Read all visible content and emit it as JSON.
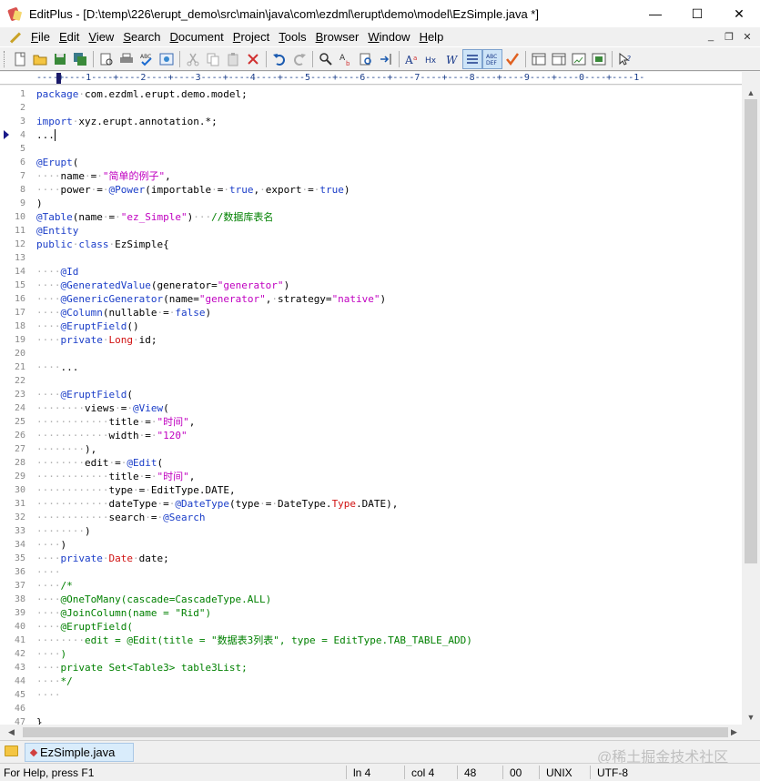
{
  "window": {
    "title": "EditPlus - [D:\\temp\\226\\erupt_demo\\src\\main\\java\\com\\ezdml\\erupt\\demo\\model\\EzSimple.java *]",
    "minimize": "—",
    "maximize": "☐",
    "close": "✕"
  },
  "menu": [
    {
      "accel": "F",
      "rest": "ile"
    },
    {
      "accel": "E",
      "rest": "dit"
    },
    {
      "accel": "V",
      "rest": "iew"
    },
    {
      "accel": "S",
      "rest": "earch"
    },
    {
      "accel": "D",
      "rest": "ocument"
    },
    {
      "accel": "P",
      "rest": "roject"
    },
    {
      "accel": "T",
      "rest": "ools"
    },
    {
      "accel": "B",
      "rest": "rowser"
    },
    {
      "accel": "W",
      "rest": "indow"
    },
    {
      "accel": "H",
      "rest": "elp"
    }
  ],
  "mdi_controls": {
    "minimize": "_",
    "restore": "❐",
    "close": "✕"
  },
  "ruler_text": "----+----1----+----2----+----3----+----4----+----5----+----6----+----7----+----8----+----9----+----0----+----1-",
  "editor": {
    "current_line": 4,
    "lines": [
      {
        "n": "1",
        "parts": [
          [
            "kw",
            "package"
          ],
          [
            "dot",
            "·"
          ],
          [
            "",
            "com.ezdml.erupt.demo.model;"
          ]
        ]
      },
      {
        "n": "2",
        "parts": []
      },
      {
        "n": "3",
        "parts": [
          [
            "kw",
            "import"
          ],
          [
            "dot",
            "·"
          ],
          [
            "",
            "xyz.erupt.annotation.*;"
          ]
        ]
      },
      {
        "n": "4",
        "parts": [
          [
            "",
            "..."
          ]
        ]
      },
      {
        "n": "5",
        "parts": []
      },
      {
        "n": "6",
        "parts": [
          [
            "ann",
            "@Erupt"
          ],
          [
            "",
            "("
          ]
        ]
      },
      {
        "n": "7",
        "parts": [
          [
            "dot",
            "····"
          ],
          [
            "",
            "name"
          ],
          [
            "dot",
            "·"
          ],
          [
            "",
            "="
          ],
          [
            "dot",
            "·"
          ],
          [
            "str",
            "\"简单的例子\""
          ],
          [
            "",
            ","
          ]
        ]
      },
      {
        "n": "8",
        "parts": [
          [
            "dot",
            "····"
          ],
          [
            "",
            "power"
          ],
          [
            "dot",
            "·"
          ],
          [
            "",
            "="
          ],
          [
            "dot",
            "·"
          ],
          [
            "ann",
            "@Power"
          ],
          [
            "",
            "(importable"
          ],
          [
            "dot",
            "·"
          ],
          [
            "",
            "="
          ],
          [
            "dot",
            "·"
          ],
          [
            "kw",
            "true"
          ],
          [
            "",
            ","
          ],
          [
            "dot",
            "·"
          ],
          [
            "",
            "export"
          ],
          [
            "dot",
            "·"
          ],
          [
            "",
            "="
          ],
          [
            "dot",
            "·"
          ],
          [
            "kw",
            "true"
          ],
          [
            "",
            ")"
          ]
        ]
      },
      {
        "n": "9",
        "parts": [
          [
            "",
            ")"
          ]
        ]
      },
      {
        "n": "10",
        "parts": [
          [
            "ann",
            "@Table"
          ],
          [
            "",
            "(name"
          ],
          [
            "dot",
            "·"
          ],
          [
            "",
            "="
          ],
          [
            "dot",
            "·"
          ],
          [
            "str",
            "\"ez_Simple\""
          ],
          [
            "",
            ")"
          ],
          [
            "dot",
            "···"
          ],
          [
            "cmt",
            "//数据库表名"
          ]
        ]
      },
      {
        "n": "11",
        "parts": [
          [
            "ann",
            "@Entity"
          ]
        ]
      },
      {
        "n": "12",
        "parts": [
          [
            "kw",
            "public"
          ],
          [
            "dot",
            "·"
          ],
          [
            "kw",
            "class"
          ],
          [
            "dot",
            "·"
          ],
          [
            "",
            "EzSimple{"
          ]
        ]
      },
      {
        "n": "13",
        "parts": []
      },
      {
        "n": "14",
        "parts": [
          [
            "dot",
            "····"
          ],
          [
            "ann",
            "@Id"
          ]
        ]
      },
      {
        "n": "15",
        "parts": [
          [
            "dot",
            "····"
          ],
          [
            "ann",
            "@GeneratedValue"
          ],
          [
            "",
            "(generator="
          ],
          [
            "str",
            "\"generator\""
          ],
          [
            "",
            ")"
          ]
        ]
      },
      {
        "n": "16",
        "parts": [
          [
            "dot",
            "····"
          ],
          [
            "ann",
            "@GenericGenerator"
          ],
          [
            "",
            "(name="
          ],
          [
            "str",
            "\"generator\""
          ],
          [
            "",
            ","
          ],
          [
            "dot",
            "·"
          ],
          [
            "",
            "strategy="
          ],
          [
            "str",
            "\"native\""
          ],
          [
            "",
            ")"
          ]
        ]
      },
      {
        "n": "17",
        "parts": [
          [
            "dot",
            "····"
          ],
          [
            "ann",
            "@Column"
          ],
          [
            "",
            "(nullable"
          ],
          [
            "dot",
            "·"
          ],
          [
            "",
            "="
          ],
          [
            "dot",
            "·"
          ],
          [
            "kw",
            "false"
          ],
          [
            "",
            ")"
          ]
        ]
      },
      {
        "n": "18",
        "parts": [
          [
            "dot",
            "····"
          ],
          [
            "ann",
            "@EruptField"
          ],
          [
            "",
            "()"
          ]
        ]
      },
      {
        "n": "19",
        "parts": [
          [
            "dot",
            "····"
          ],
          [
            "kw",
            "private"
          ],
          [
            "dot",
            "·"
          ],
          [
            "typ",
            "Long"
          ],
          [
            "dot",
            "·"
          ],
          [
            "",
            "id;"
          ]
        ]
      },
      {
        "n": "20",
        "parts": []
      },
      {
        "n": "21",
        "parts": [
          [
            "dot",
            "····"
          ],
          [
            "",
            "..."
          ]
        ]
      },
      {
        "n": "22",
        "parts": []
      },
      {
        "n": "23",
        "parts": [
          [
            "dot",
            "····"
          ],
          [
            "ann",
            "@EruptField"
          ],
          [
            "",
            "("
          ]
        ]
      },
      {
        "n": "24",
        "parts": [
          [
            "dot",
            "········"
          ],
          [
            "",
            "views"
          ],
          [
            "dot",
            "·"
          ],
          [
            "",
            "="
          ],
          [
            "dot",
            "·"
          ],
          [
            "ann",
            "@View"
          ],
          [
            "",
            "("
          ]
        ]
      },
      {
        "n": "25",
        "parts": [
          [
            "dot",
            "············"
          ],
          [
            "",
            "title"
          ],
          [
            "dot",
            "·"
          ],
          [
            "",
            "="
          ],
          [
            "dot",
            "·"
          ],
          [
            "str",
            "\"时间\""
          ],
          [
            "",
            ","
          ]
        ]
      },
      {
        "n": "26",
        "parts": [
          [
            "dot",
            "············"
          ],
          [
            "",
            "width"
          ],
          [
            "dot",
            "·"
          ],
          [
            "",
            "="
          ],
          [
            "dot",
            "·"
          ],
          [
            "str",
            "\"120\""
          ]
        ]
      },
      {
        "n": "27",
        "parts": [
          [
            "dot",
            "········"
          ],
          [
            "",
            "),"
          ]
        ]
      },
      {
        "n": "28",
        "parts": [
          [
            "dot",
            "········"
          ],
          [
            "",
            "edit"
          ],
          [
            "dot",
            "·"
          ],
          [
            "",
            "="
          ],
          [
            "dot",
            "·"
          ],
          [
            "ann",
            "@Edit"
          ],
          [
            "",
            "("
          ]
        ]
      },
      {
        "n": "29",
        "parts": [
          [
            "dot",
            "············"
          ],
          [
            "",
            "title"
          ],
          [
            "dot",
            "·"
          ],
          [
            "",
            "="
          ],
          [
            "dot",
            "·"
          ],
          [
            "str",
            "\"时间\""
          ],
          [
            "",
            ","
          ]
        ]
      },
      {
        "n": "30",
        "parts": [
          [
            "dot",
            "············"
          ],
          [
            "",
            "type"
          ],
          [
            "dot",
            "·"
          ],
          [
            "",
            "="
          ],
          [
            "dot",
            "·"
          ],
          [
            "",
            "EditType.DATE,"
          ]
        ]
      },
      {
        "n": "31",
        "parts": [
          [
            "dot",
            "············"
          ],
          [
            "",
            "dateType"
          ],
          [
            "dot",
            "·"
          ],
          [
            "",
            "="
          ],
          [
            "dot",
            "·"
          ],
          [
            "ann",
            "@DateType"
          ],
          [
            "",
            "(type"
          ],
          [
            "dot",
            "·"
          ],
          [
            "",
            "="
          ],
          [
            "dot",
            "·"
          ],
          [
            "",
            "DateType."
          ],
          [
            "typ",
            "Type"
          ],
          [
            "",
            ".DATE),"
          ]
        ]
      },
      {
        "n": "32",
        "parts": [
          [
            "dot",
            "············"
          ],
          [
            "",
            "search"
          ],
          [
            "dot",
            "·"
          ],
          [
            "",
            "="
          ],
          [
            "dot",
            "·"
          ],
          [
            "ann",
            "@Search"
          ]
        ]
      },
      {
        "n": "33",
        "parts": [
          [
            "dot",
            "········"
          ],
          [
            "",
            ")"
          ]
        ]
      },
      {
        "n": "34",
        "parts": [
          [
            "dot",
            "····"
          ],
          [
            "",
            ")"
          ]
        ]
      },
      {
        "n": "35",
        "parts": [
          [
            "dot",
            "····"
          ],
          [
            "kw",
            "private"
          ],
          [
            "dot",
            "·"
          ],
          [
            "typ",
            "Date"
          ],
          [
            "dot",
            "·"
          ],
          [
            "",
            "date;"
          ]
        ]
      },
      {
        "n": "36",
        "parts": [
          [
            "dot",
            "····"
          ]
        ]
      },
      {
        "n": "37",
        "parts": [
          [
            "dot",
            "····"
          ],
          [
            "cmt",
            "/*"
          ]
        ]
      },
      {
        "n": "38",
        "parts": [
          [
            "dot",
            "····"
          ],
          [
            "cmt",
            "@OneToMany(cascade=CascadeType.ALL)"
          ]
        ]
      },
      {
        "n": "39",
        "parts": [
          [
            "dot",
            "····"
          ],
          [
            "cmt",
            "@JoinColumn(name = \"Rid\")"
          ]
        ]
      },
      {
        "n": "40",
        "parts": [
          [
            "dot",
            "····"
          ],
          [
            "cmt",
            "@EruptField("
          ]
        ]
      },
      {
        "n": "41",
        "parts": [
          [
            "dot",
            "········"
          ],
          [
            "cmt",
            "edit = @Edit(title = \"数据表3列表\", type = EditType.TAB_TABLE_ADD)"
          ]
        ]
      },
      {
        "n": "42",
        "parts": [
          [
            "dot",
            "····"
          ],
          [
            "cmt",
            ")"
          ]
        ]
      },
      {
        "n": "43",
        "parts": [
          [
            "dot",
            "····"
          ],
          [
            "cmt",
            "private Set<Table3> table3List;"
          ]
        ]
      },
      {
        "n": "44",
        "parts": [
          [
            "dot",
            "····"
          ],
          [
            "cmt",
            "*/"
          ]
        ]
      },
      {
        "n": "45",
        "parts": [
          [
            "dot",
            "····"
          ]
        ]
      },
      {
        "n": "46",
        "parts": []
      },
      {
        "n": "47",
        "parts": [
          [
            "",
            "}"
          ]
        ]
      }
    ]
  },
  "tab": {
    "label": "EzSimple.java"
  },
  "watermark": "@稀土掘金技术社区",
  "status": {
    "help": "For Help, press F1",
    "line": "ln 4",
    "col": "col 4",
    "num": "48",
    "flags": "00",
    "eol": "UNIX",
    "encoding": "UTF-8"
  }
}
